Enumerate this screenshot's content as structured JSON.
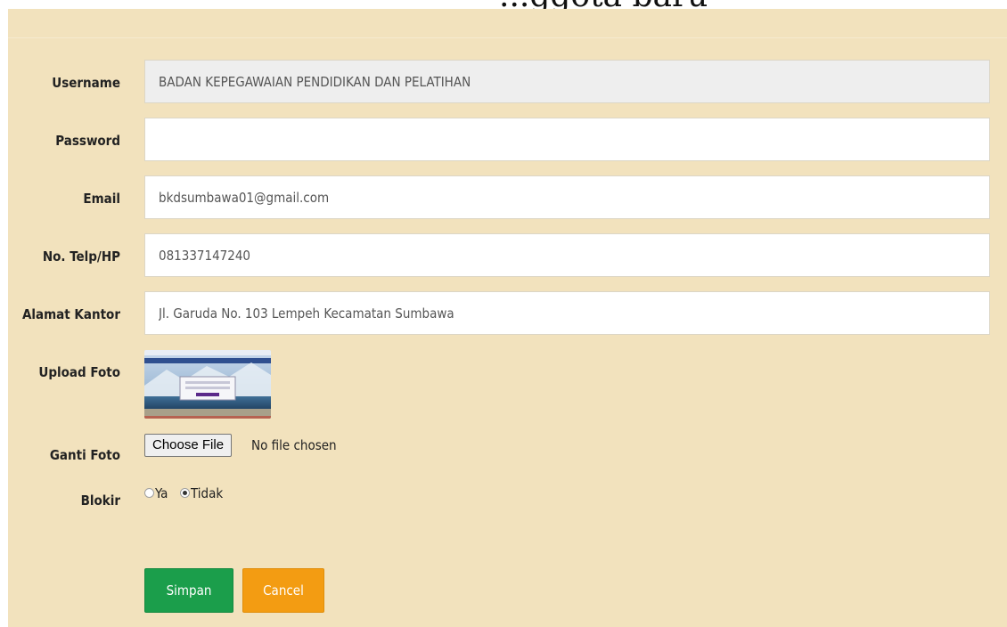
{
  "header": {
    "partial_title": "...ggota baru"
  },
  "form": {
    "username": {
      "label": "Username",
      "value": "BADAN KEPEGAWAIAN PENDIDIKAN DAN PELATIHAN"
    },
    "password": {
      "label": "Password",
      "value": ""
    },
    "email": {
      "label": "Email",
      "value": "bkdsumbawa01@gmail.com"
    },
    "phone": {
      "label": "No. Telp/HP",
      "value": "081337147240"
    },
    "address": {
      "label": "Alamat Kantor",
      "value": "Jl. Garuda No. 103 Lempeh Kecamatan Sumbawa"
    },
    "upload_photo": {
      "label": "Upload Foto"
    },
    "change_photo": {
      "label": "Ganti Foto",
      "button_label": "Choose File",
      "status": "No file chosen"
    },
    "block": {
      "label": "Blokir",
      "options": [
        {
          "label": "Ya",
          "checked": false
        },
        {
          "label": "Tidak",
          "checked": true
        }
      ]
    }
  },
  "buttons": {
    "save_label": "Simpan",
    "cancel_label": "Cancel"
  },
  "colors": {
    "panel_bg": "#f2e2bd",
    "save": "#1b9e4b",
    "cancel": "#f39c12"
  }
}
